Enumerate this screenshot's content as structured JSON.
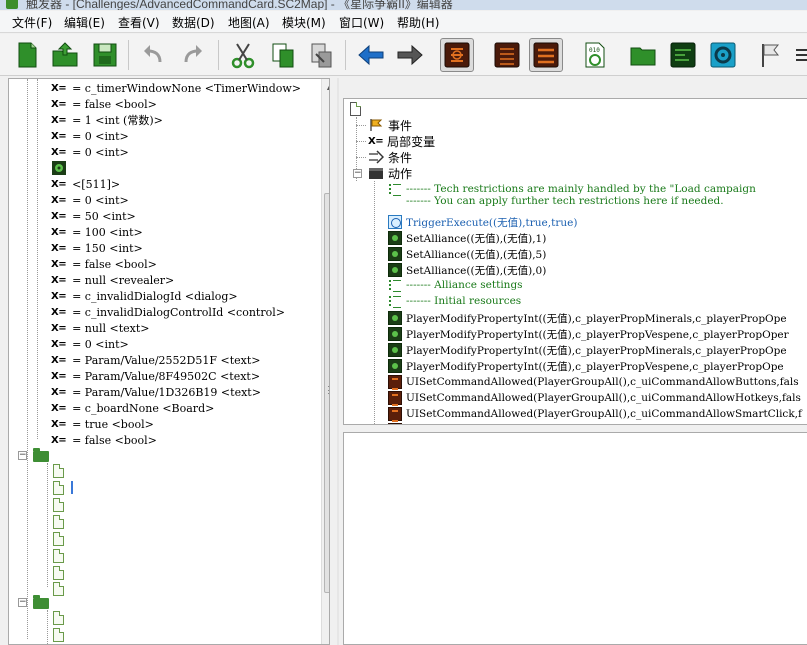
{
  "window": {
    "title": "触发器 - [Challenges/AdvancedCommandCard.SC2Map] - 《星际争霸II》编辑器"
  },
  "menubar": {
    "items": [
      "文件(F)",
      "编辑(E)",
      "查看(V)",
      "数据(D)",
      "地图(A)",
      "模块(M)",
      "窗口(W)",
      "帮助(H)"
    ]
  },
  "toolbar": {
    "buttons": [
      "new-file",
      "open-file",
      "save",
      "undo",
      "redo",
      "cut",
      "copy",
      "paste",
      "back",
      "forward",
      "trigger-module",
      "trigger-list",
      "trigger-list-alt",
      "text-module",
      "folder",
      "terrain",
      "settings",
      "flag"
    ]
  },
  "left_tree": {
    "rows": [
      {
        "text": "= c_timerWindowNone <TimerWindow>"
      },
      {
        "text": "= false <bool>"
      },
      {
        "text": "= 1 <int (常数)>"
      },
      {
        "text": "= 0 <int>"
      },
      {
        "text": "= 0 <int>"
      },
      {
        "text": ""
      },
      {
        "text": "<[511]>"
      },
      {
        "text": "= 0 <int>"
      },
      {
        "text": "= 50 <int>"
      },
      {
        "text": "= 100 <int>"
      },
      {
        "text": "= 150 <int>"
      },
      {
        "text": "= false <bool>"
      },
      {
        "text": "= null <revealer>"
      },
      {
        "text": "= c_invalidDialogId <dialog>"
      },
      {
        "text": "= c_invalidDialogControlId <control>"
      },
      {
        "text": "= null <text>"
      },
      {
        "text": "= 0 <int>"
      },
      {
        "text": "= Param/Value/2552D51F <text>"
      },
      {
        "text": "= Param/Value/8F49502C <text>"
      },
      {
        "text": "= Param/Value/1D326B19 <text>"
      },
      {
        "text": "= c_boardNone <Board>"
      },
      {
        "text": "= true <bool>"
      },
      {
        "text": "= false <bool>"
      }
    ],
    "x_label": "X="
  },
  "right_tree": {
    "header": {
      "event": "事件",
      "local_vars": "局部变量",
      "conditions": "条件",
      "actions": "动作",
      "x_label": "X="
    },
    "rows": [
      {
        "kind": "comment",
        "text": "------- Tech restrictions are mainly handled by the \"Load campaign"
      },
      {
        "kind": "comment",
        "text": "------- You can apply further tech restrictions here if needed."
      },
      {
        "kind": "trigger",
        "text": "TriggerExecute((无值),true,true)"
      },
      {
        "kind": "green",
        "text": "SetAlliance((无值),(无值),1)"
      },
      {
        "kind": "green",
        "text": "SetAlliance((无值),(无值),5)"
      },
      {
        "kind": "green",
        "text": "SetAlliance((无值),(无值),0)"
      },
      {
        "kind": "comment",
        "text": "------- Alliance settings"
      },
      {
        "kind": "comment",
        "text": "------- Initial resources"
      },
      {
        "kind": "green",
        "text": "PlayerModifyPropertyInt((无值),c_playerPropMinerals,c_playerPropOpe"
      },
      {
        "kind": "green",
        "text": "PlayerModifyPropertyInt((无值),c_playerPropVespene,c_playerPropOper"
      },
      {
        "kind": "green",
        "text": "PlayerModifyPropertyInt((无值),c_playerPropMinerals,c_playerPropOpe"
      },
      {
        "kind": "green",
        "text": "PlayerModifyPropertyInt((无值),c_playerPropVespene,c_playerPropOpe"
      },
      {
        "kind": "orange",
        "text": "UISetCommandAllowed(PlayerGroupAll(),c_uiCommandAllowButtons,fals"
      },
      {
        "kind": "orange",
        "text": "UISetCommandAllowed(PlayerGroupAll(),c_uiCommandAllowHotkeys,fals"
      },
      {
        "kind": "orange",
        "text": "UISetCommandAllowed(PlayerGroupAll(),c_uiCommandAllowSmartClick,f"
      }
    ]
  },
  "colors": {
    "comment_green": "#1a7a1a",
    "trigger_blue": "#1a5fb0",
    "folder_green": "#3e8e34"
  }
}
